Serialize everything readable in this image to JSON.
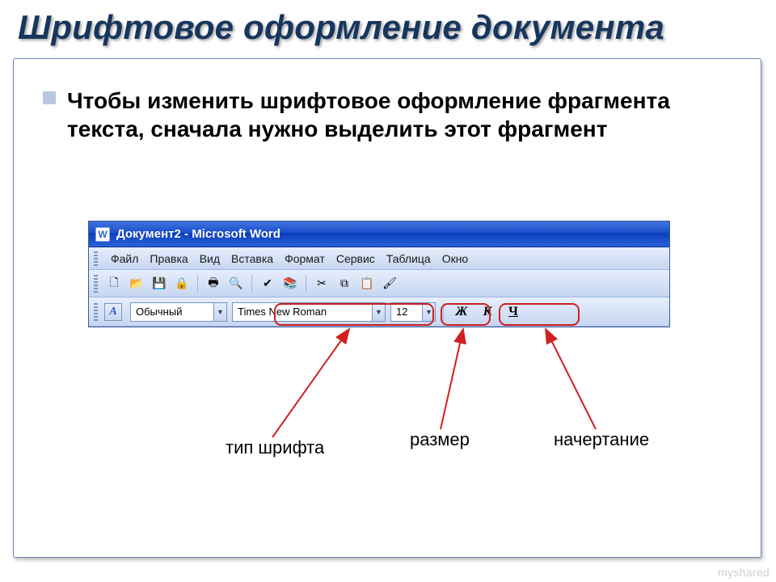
{
  "title": "Шрифтовое оформление документа",
  "body": "Чтобы изменить шрифтовое оформление фрагмента текста, сначала нужно выделить этот фрагмент",
  "word": {
    "icon_letter": "W",
    "window_title": "Документ2 - Microsoft Word",
    "menus": [
      "Файл",
      "Правка",
      "Вид",
      "Вставка",
      "Формат",
      "Сервис",
      "Таблица",
      "Окно"
    ],
    "toolbar_icons": {
      "new": "🗋",
      "open": "📂",
      "save": "💾",
      "permission": "🔒",
      "print": "🖶",
      "preview": "🔍",
      "spell": "✔",
      "research": "📚",
      "cut": "✂",
      "copy": "⧉",
      "paste": "📋",
      "format_painter": "🖌"
    },
    "style_prefix": "A",
    "style_dropdown": "Обычный",
    "font_dropdown": "Times New Roman",
    "size_dropdown": "12",
    "bold": "Ж",
    "italic": "К",
    "underline": "Ч"
  },
  "callouts": {
    "font_type": "тип шрифта",
    "size": "размер",
    "style": "начертание"
  },
  "watermark": "myshared"
}
